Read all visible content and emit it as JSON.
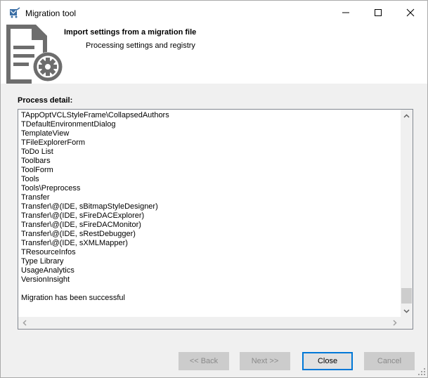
{
  "window": {
    "title": "Migration tool"
  },
  "header": {
    "title": "Import settings from a migration file",
    "subtitle": "Processing settings and registry"
  },
  "process_detail": {
    "label": "Process detail:",
    "lines": [
      "TAppOptVCLStyleFrame\\CollapsedAuthors",
      "TDefaultEnvironmentDialog",
      "TemplateView",
      "TFileExplorerForm",
      "ToDo List",
      "Toolbars",
      "ToolForm",
      "Tools",
      "Tools\\Preprocess",
      "Transfer",
      "Transfer\\@(IDE, sBitmapStyleDesigner)",
      "Transfer\\@(IDE, sFireDACExplorer)",
      "Transfer\\@(IDE, sFireDACMonitor)",
      "Transfer\\@(IDE, sRestDebugger)",
      "Transfer\\@(IDE, sXMLMapper)",
      "TResourceInfos",
      "Type Library",
      "UsageAnalytics",
      "VersionInsight",
      "",
      "Migration has been successful"
    ]
  },
  "buttons": {
    "back": "<< Back",
    "next": "Next >>",
    "close": "Close",
    "cancel": "Cancel"
  },
  "colors": {
    "focus_border": "#0078d7",
    "disabled_button": "#cccccc",
    "disabled_text": "#8a8a8a",
    "header_icon": "#6d6d6d"
  }
}
